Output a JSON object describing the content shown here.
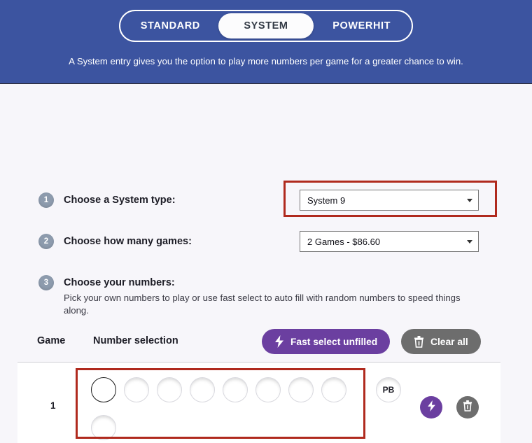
{
  "header": {
    "tabs": [
      {
        "label": "STANDARD",
        "active": false
      },
      {
        "label": "SYSTEM",
        "active": true
      },
      {
        "label": "POWERHIT",
        "active": false
      }
    ],
    "subtitle": "A System entry gives you the option to play more numbers per game for a greater chance to win."
  },
  "steps": {
    "step1": {
      "number": "1",
      "label": "Choose a System type:",
      "select_value": "System 9",
      "caret_icon": "chevron-down-icon",
      "highlighted": true
    },
    "step2": {
      "number": "2",
      "label": "Choose how many games:",
      "select_value": "2 Games - $86.60",
      "caret_icon": "chevron-down-icon"
    },
    "step3": {
      "number": "3",
      "label": "Choose your numbers:",
      "description": "Pick your own numbers to play or use fast select to auto fill with random numbers to speed things along."
    }
  },
  "table": {
    "col_game": "Game",
    "col_numbers": "Number selection",
    "fast_select_label": "Fast select unfilled",
    "fast_select_icon": "lightning-bolt-icon",
    "clear_all_label": "Clear all",
    "clear_all_icon": "trash-icon",
    "rows": [
      {
        "index": "1",
        "main_balls": [
          "",
          "",
          "",
          "",
          "",
          "",
          "",
          "",
          ""
        ],
        "active_ball_index": 0,
        "powerball_label": "PB",
        "row_fast_select_icon": "lightning-bolt-icon",
        "row_clear_icon": "trash-icon"
      }
    ]
  },
  "colors": {
    "header_blue": "#3c54a0",
    "accent_purple": "#6b3fa0",
    "neutral_gray": "#6d6d6d",
    "highlight_red": "#b02a1e",
    "badge_gray": "#8d9bad"
  }
}
